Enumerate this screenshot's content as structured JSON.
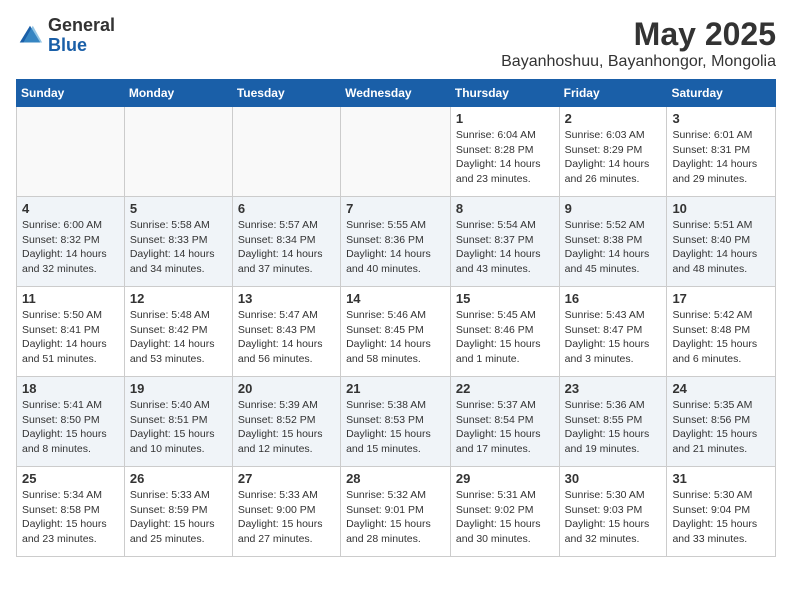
{
  "header": {
    "logo_general": "General",
    "logo_blue": "Blue",
    "month_title": "May 2025",
    "location": "Bayanhoshuu, Bayanhongor, Mongolia"
  },
  "days_of_week": [
    "Sunday",
    "Monday",
    "Tuesday",
    "Wednesday",
    "Thursday",
    "Friday",
    "Saturday"
  ],
  "weeks": [
    [
      {
        "day": "",
        "info": ""
      },
      {
        "day": "",
        "info": ""
      },
      {
        "day": "",
        "info": ""
      },
      {
        "day": "",
        "info": ""
      },
      {
        "day": "1",
        "info": "Sunrise: 6:04 AM\nSunset: 8:28 PM\nDaylight: 14 hours\nand 23 minutes."
      },
      {
        "day": "2",
        "info": "Sunrise: 6:03 AM\nSunset: 8:29 PM\nDaylight: 14 hours\nand 26 minutes."
      },
      {
        "day": "3",
        "info": "Sunrise: 6:01 AM\nSunset: 8:31 PM\nDaylight: 14 hours\nand 29 minutes."
      }
    ],
    [
      {
        "day": "4",
        "info": "Sunrise: 6:00 AM\nSunset: 8:32 PM\nDaylight: 14 hours\nand 32 minutes."
      },
      {
        "day": "5",
        "info": "Sunrise: 5:58 AM\nSunset: 8:33 PM\nDaylight: 14 hours\nand 34 minutes."
      },
      {
        "day": "6",
        "info": "Sunrise: 5:57 AM\nSunset: 8:34 PM\nDaylight: 14 hours\nand 37 minutes."
      },
      {
        "day": "7",
        "info": "Sunrise: 5:55 AM\nSunset: 8:36 PM\nDaylight: 14 hours\nand 40 minutes."
      },
      {
        "day": "8",
        "info": "Sunrise: 5:54 AM\nSunset: 8:37 PM\nDaylight: 14 hours\nand 43 minutes."
      },
      {
        "day": "9",
        "info": "Sunrise: 5:52 AM\nSunset: 8:38 PM\nDaylight: 14 hours\nand 45 minutes."
      },
      {
        "day": "10",
        "info": "Sunrise: 5:51 AM\nSunset: 8:40 PM\nDaylight: 14 hours\nand 48 minutes."
      }
    ],
    [
      {
        "day": "11",
        "info": "Sunrise: 5:50 AM\nSunset: 8:41 PM\nDaylight: 14 hours\nand 51 minutes."
      },
      {
        "day": "12",
        "info": "Sunrise: 5:48 AM\nSunset: 8:42 PM\nDaylight: 14 hours\nand 53 minutes."
      },
      {
        "day": "13",
        "info": "Sunrise: 5:47 AM\nSunset: 8:43 PM\nDaylight: 14 hours\nand 56 minutes."
      },
      {
        "day": "14",
        "info": "Sunrise: 5:46 AM\nSunset: 8:45 PM\nDaylight: 14 hours\nand 58 minutes."
      },
      {
        "day": "15",
        "info": "Sunrise: 5:45 AM\nSunset: 8:46 PM\nDaylight: 15 hours\nand 1 minute."
      },
      {
        "day": "16",
        "info": "Sunrise: 5:43 AM\nSunset: 8:47 PM\nDaylight: 15 hours\nand 3 minutes."
      },
      {
        "day": "17",
        "info": "Sunrise: 5:42 AM\nSunset: 8:48 PM\nDaylight: 15 hours\nand 6 minutes."
      }
    ],
    [
      {
        "day": "18",
        "info": "Sunrise: 5:41 AM\nSunset: 8:50 PM\nDaylight: 15 hours\nand 8 minutes."
      },
      {
        "day": "19",
        "info": "Sunrise: 5:40 AM\nSunset: 8:51 PM\nDaylight: 15 hours\nand 10 minutes."
      },
      {
        "day": "20",
        "info": "Sunrise: 5:39 AM\nSunset: 8:52 PM\nDaylight: 15 hours\nand 12 minutes."
      },
      {
        "day": "21",
        "info": "Sunrise: 5:38 AM\nSunset: 8:53 PM\nDaylight: 15 hours\nand 15 minutes."
      },
      {
        "day": "22",
        "info": "Sunrise: 5:37 AM\nSunset: 8:54 PM\nDaylight: 15 hours\nand 17 minutes."
      },
      {
        "day": "23",
        "info": "Sunrise: 5:36 AM\nSunset: 8:55 PM\nDaylight: 15 hours\nand 19 minutes."
      },
      {
        "day": "24",
        "info": "Sunrise: 5:35 AM\nSunset: 8:56 PM\nDaylight: 15 hours\nand 21 minutes."
      }
    ],
    [
      {
        "day": "25",
        "info": "Sunrise: 5:34 AM\nSunset: 8:58 PM\nDaylight: 15 hours\nand 23 minutes."
      },
      {
        "day": "26",
        "info": "Sunrise: 5:33 AM\nSunset: 8:59 PM\nDaylight: 15 hours\nand 25 minutes."
      },
      {
        "day": "27",
        "info": "Sunrise: 5:33 AM\nSunset: 9:00 PM\nDaylight: 15 hours\nand 27 minutes."
      },
      {
        "day": "28",
        "info": "Sunrise: 5:32 AM\nSunset: 9:01 PM\nDaylight: 15 hours\nand 28 minutes."
      },
      {
        "day": "29",
        "info": "Sunrise: 5:31 AM\nSunset: 9:02 PM\nDaylight: 15 hours\nand 30 minutes."
      },
      {
        "day": "30",
        "info": "Sunrise: 5:30 AM\nSunset: 9:03 PM\nDaylight: 15 hours\nand 32 minutes."
      },
      {
        "day": "31",
        "info": "Sunrise: 5:30 AM\nSunset: 9:04 PM\nDaylight: 15 hours\nand 33 minutes."
      }
    ]
  ]
}
